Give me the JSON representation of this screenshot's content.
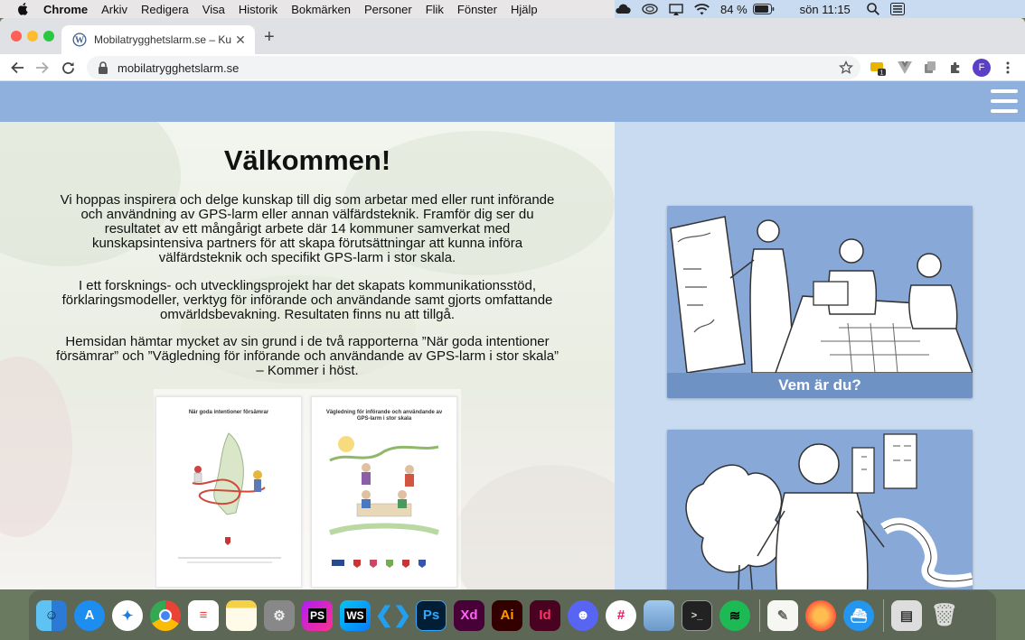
{
  "menubar": {
    "app_name": "Chrome",
    "items": [
      "Arkiv",
      "Redigera",
      "Visa",
      "Historik",
      "Bokmärken",
      "Personer",
      "Flik",
      "Fönster",
      "Hjälp"
    ],
    "battery": "84 %",
    "clock": "sön 11:15"
  },
  "browser": {
    "tab_title": "Mobilatrygghetslarm.se – Kuns",
    "url": "mobilatrygghetslarm.se",
    "extension_badge": "1",
    "profile_initial": "F"
  },
  "page": {
    "welcome_title": "Välkommen!",
    "paragraphs": [
      "Vi hoppas inspirera och delge kunskap till dig som arbetar med eller runt införande och användning av GPS-larm eller annan välfärdsteknik. Framför dig ser du resultatet av ett mångårigt arbete där 14 kommuner samverkat med kunskapsintensiva partners för att skapa förutsättningar att kunna införa välfärdsteknik och specifikt GPS-larm i stor skala.",
      "I ett forsknings- och utvecklingsprojekt har det skapats kommunikationsstöd, förklaringsmodeller, verktyg för införande och användande samt gjorts omfattande omvärldsbevakning. Resultaten finns nu att tillgå.",
      "Hemsidan hämtar mycket av sin grund i de två rapporterna ”När goda intentioner försämrar” och ”Vägledning för införande och användande av GPS-larm i stor skala” – Kommer i höst."
    ],
    "books": [
      {
        "title": "När goda intentioner försämrar"
      },
      {
        "title": "Vägledning för införande och användande av GPS-larm i stor skala"
      }
    ],
    "cards": [
      {
        "caption": "Vem är du?"
      },
      {
        "caption": ""
      }
    ]
  },
  "dock": {
    "apps": [
      "finder",
      "app-store",
      "safari",
      "chrome",
      "reminders",
      "notes",
      "system-preferences",
      "phpstorm",
      "webstorm",
      "vscode",
      "photoshop",
      "xd",
      "illustrator",
      "indesign",
      "discord",
      "slack",
      "preview",
      "terminal",
      "spotify",
      "textedit",
      "firefox",
      "docker",
      "archive",
      "trash"
    ],
    "labels": {
      "phpstorm": "PS",
      "webstorm": "WS",
      "photoshop": "Ps",
      "xd": "Xd",
      "illustrator": "Ai",
      "indesign": "Id"
    }
  }
}
